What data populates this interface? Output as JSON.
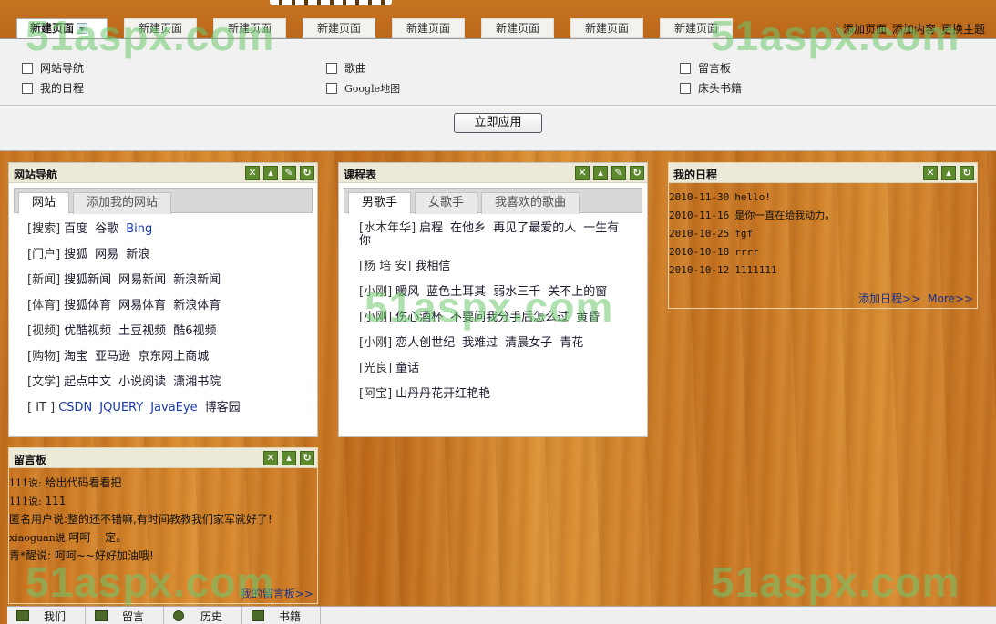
{
  "top": {
    "page_tabs": [
      "新建页面",
      "新建页面",
      "新建页面",
      "新建页面",
      "新建页面",
      "新建页面",
      "新建页面",
      "新建页面",
      "新建页面"
    ],
    "actions": [
      "添加页面",
      "添加内容",
      "更换主题>>"
    ]
  },
  "settings": {
    "options": [
      {
        "label": "网站导航"
      },
      {
        "label": "歌曲"
      },
      {
        "label": "留言板"
      },
      {
        "label": "我的日程"
      },
      {
        "label": "Google地图"
      },
      {
        "label": "床头书籍"
      }
    ],
    "apply_label": "立即应用"
  },
  "nav_widget": {
    "title": "网站导航",
    "tabs": [
      "网站",
      "添加我的网站"
    ],
    "rows": [
      {
        "cat": "[搜索]",
        "links": [
          "百度",
          "谷歌",
          "Bing"
        ]
      },
      {
        "cat": "[门户]",
        "links": [
          "搜狐",
          "网易",
          "新浪"
        ]
      },
      {
        "cat": "[新闻]",
        "links": [
          "搜狐新闻",
          "网易新闻",
          "新浪新闻"
        ]
      },
      {
        "cat": "[体育]",
        "links": [
          "搜狐体育",
          "网易体育",
          "新浪体育"
        ]
      },
      {
        "cat": "[视频]",
        "links": [
          "优酷视频",
          "土豆视频",
          "酷6视频"
        ]
      },
      {
        "cat": "[购物]",
        "links": [
          "淘宝",
          "亚马逊",
          "京东网上商城"
        ]
      },
      {
        "cat": "[文学]",
        "links": [
          "起点中文",
          "小说阅读",
          "潇湘书院"
        ]
      },
      {
        "cat": "[ IT ]",
        "links": [
          "CSDN",
          "JQUERY",
          "JavaEye",
          "博客园"
        ]
      }
    ]
  },
  "song_widget": {
    "title": "课程表",
    "tabs": [
      "男歌手",
      "女歌手",
      "我喜欢的歌曲"
    ],
    "rows": [
      {
        "cat": "[水木年华]",
        "links": [
          "启程",
          "在他乡",
          "再见了最爱的人",
          "一生有你"
        ]
      },
      {
        "cat": "[杨 培 安]",
        "links": [
          "我相信"
        ]
      },
      {
        "cat": "[小刚]",
        "links": [
          "暖风",
          "蓝色土耳其",
          "弱水三千",
          "关不上的窗"
        ]
      },
      {
        "cat": "[小刚]",
        "links": [
          "伤心酒杯",
          "不要问我分手后怎么过",
          "黄昏"
        ]
      },
      {
        "cat": "[小刚]",
        "links": [
          "恋人创世纪",
          "我难过",
          "清晨女子",
          "青花"
        ]
      },
      {
        "cat": "[光良]",
        "links": [
          "童话"
        ]
      },
      {
        "cat": "[阿宝]",
        "links": [
          "山丹丹花开红艳艳"
        ]
      }
    ]
  },
  "diary_widget": {
    "title": "我的日程",
    "entries": [
      {
        "date": "2010-11-30",
        "text": "hello!"
      },
      {
        "date": "2010-11-16",
        "text": "是你一直在给我动力。"
      },
      {
        "date": "2010-10-25",
        "text": "fgf"
      },
      {
        "date": "2010-10-18",
        "text": "rrrr"
      },
      {
        "date": "2010-10-12",
        "text": "1111111"
      }
    ],
    "add_label": "添加日程>>",
    "more_label": "More>>"
  },
  "message_widget": {
    "title": "留言板",
    "messages": [
      {
        "user": "111说:",
        "text": "给出代码看看把"
      },
      {
        "user": "111说:",
        "text": "111"
      },
      {
        "user": "匿名用户说:",
        "text": "整的还不错嘛,有时间教教我们家军就好了!"
      },
      {
        "user": "xiaoguan说:",
        "text": "呵呵 一定。"
      },
      {
        "user": "青*醒说:",
        "text": "呵呵~~好好加油哦!"
      }
    ],
    "more_label": "我的留言板>>"
  },
  "bottom_bar": [
    "我们",
    "留言",
    "历史",
    "书籍"
  ],
  "watermark": "51aspx.com",
  "colors": {
    "widget_head": "#ece9d8",
    "button_green": "#5e8a2e",
    "link_blue": "#1a3ca8",
    "wood": "#d08028"
  }
}
